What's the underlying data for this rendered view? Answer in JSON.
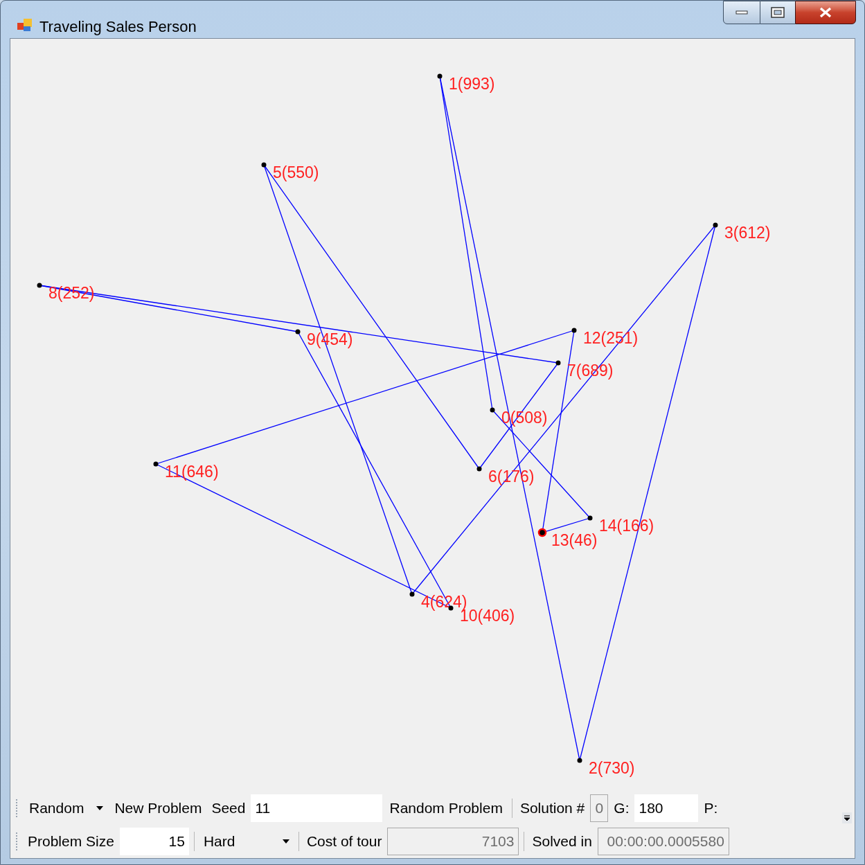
{
  "window": {
    "title": "Traveling Sales Person"
  },
  "nodes": [
    {
      "label": "0(508)",
      "start": false
    },
    {
      "label": "1(993)",
      "start": false
    },
    {
      "label": "2(730)",
      "start": false
    },
    {
      "label": "3(612)",
      "start": false
    },
    {
      "label": "4(624)",
      "start": false
    },
    {
      "label": "5(550)",
      "start": false
    },
    {
      "label": "6(176)",
      "start": false
    },
    {
      "label": "7(689)",
      "start": false
    },
    {
      "label": "8(252)",
      "start": false
    },
    {
      "label": "9(454)",
      "start": false
    },
    {
      "label": "10(406)",
      "start": false
    },
    {
      "label": "11(646)",
      "start": false
    },
    {
      "label": "12(251)",
      "start": false
    },
    {
      "label": "13(46)",
      "start": true
    },
    {
      "label": "14(166)",
      "start": false
    }
  ],
  "toolbars": [
    {
      "items": [
        {
          "kind": "dropdown",
          "text": "Random"
        },
        {
          "kind": "button",
          "text": "New Problem"
        },
        {
          "kind": "label",
          "text": "Seed"
        },
        {
          "kind": "field",
          "text": "11"
        },
        {
          "kind": "button",
          "text": "Random Problem"
        },
        {
          "kind": "separator"
        },
        {
          "kind": "label",
          "text": "Solution #"
        },
        {
          "kind": "readonly",
          "text": "0"
        },
        {
          "kind": "label",
          "text": "G:"
        },
        {
          "kind": "field",
          "text": "180"
        },
        {
          "kind": "label",
          "text": "P:"
        }
      ],
      "overflow": true
    },
    {
      "items": [
        {
          "kind": "label",
          "text": "Problem Size"
        },
        {
          "kind": "field",
          "text": "15"
        },
        {
          "kind": "separator"
        },
        {
          "kind": "dropdown",
          "text": "Hard"
        },
        {
          "kind": "separator"
        },
        {
          "kind": "label",
          "text": "Cost of tour"
        },
        {
          "kind": "readonly",
          "text": "7103"
        },
        {
          "kind": "separator"
        },
        {
          "kind": "label",
          "text": "Solved in"
        },
        {
          "kind": "readonly",
          "text": "00:00:00.0005580"
        }
      ]
    }
  ]
}
